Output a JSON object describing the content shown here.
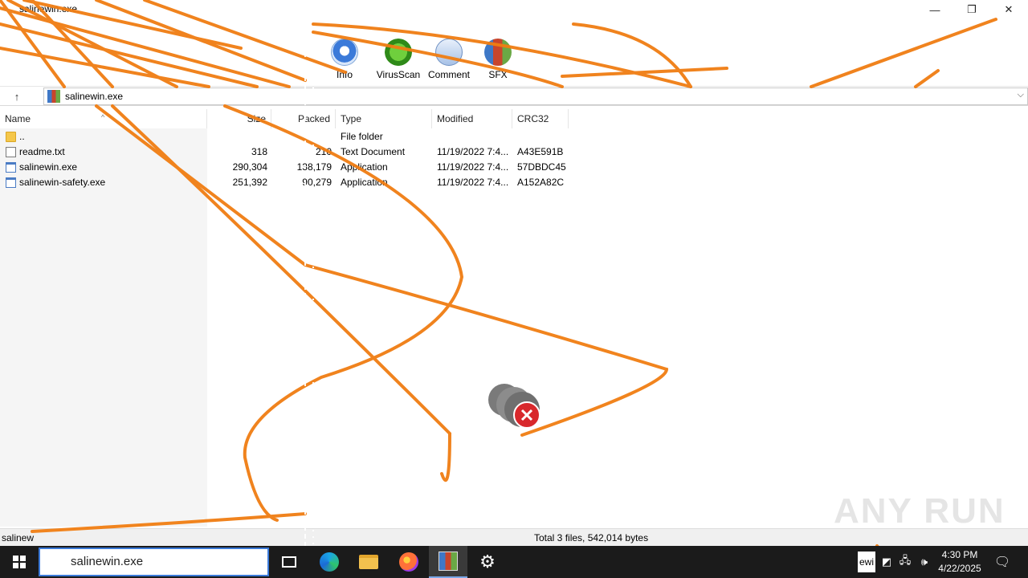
{
  "window": {
    "title": "salinewin.exe",
    "minimize_glyph": "—",
    "restore_glyph": "❐",
    "close_glyph": "✕"
  },
  "toolbar": {
    "items": [
      {
        "label": "Info",
        "icon": "info-icon"
      },
      {
        "label": "VirusScan",
        "icon": "virusscan-icon"
      },
      {
        "label": "Comment",
        "icon": "comment-icon"
      },
      {
        "label": "SFX",
        "icon": "sfx-icon"
      }
    ]
  },
  "address": {
    "up_glyph": "↑",
    "path": "salinewin.exe",
    "dropdown_glyph": "⌵"
  },
  "columns": {
    "name": "Name",
    "size": "Size",
    "packed": "Packed",
    "type": "Type",
    "modified": "Modified",
    "crc": "CRC32"
  },
  "files": [
    {
      "name": "..",
      "size": "",
      "packed": "",
      "type": "File folder",
      "modified": "",
      "crc": "",
      "icon": "folder-icon"
    },
    {
      "name": "readme.txt",
      "size": "318",
      "packed": "210",
      "type": "Text Document",
      "modified": "11/19/2022 7:4...",
      "crc": "A43E591B",
      "icon": "text-file-icon"
    },
    {
      "name": "salinewin.exe",
      "size": "290,304",
      "packed": "138,179",
      "type": "Application",
      "modified": "11/19/2022 7:4...",
      "crc": "57DBDC45",
      "icon": "exe-file-icon"
    },
    {
      "name": "salinewin-safety.exe",
      "size": "251,392",
      "packed": "90,279",
      "type": "Application",
      "modified": "11/19/2022 7:4...",
      "crc": "A152A82C",
      "icon": "exe-file-icon"
    }
  ],
  "status": {
    "left": "salinew",
    "total": "Total 3 files, 542,014 bytes"
  },
  "watermark": "ANY RUN",
  "taskbar": {
    "search_value": "salinewin.exe",
    "tray_text": "ewi",
    "time": "4:30 PM",
    "date": "4/22/2025"
  },
  "colors": {
    "scribble": "#f07d12",
    "accent": "#3b7ad9",
    "taskbar": "#1b1b1b"
  }
}
